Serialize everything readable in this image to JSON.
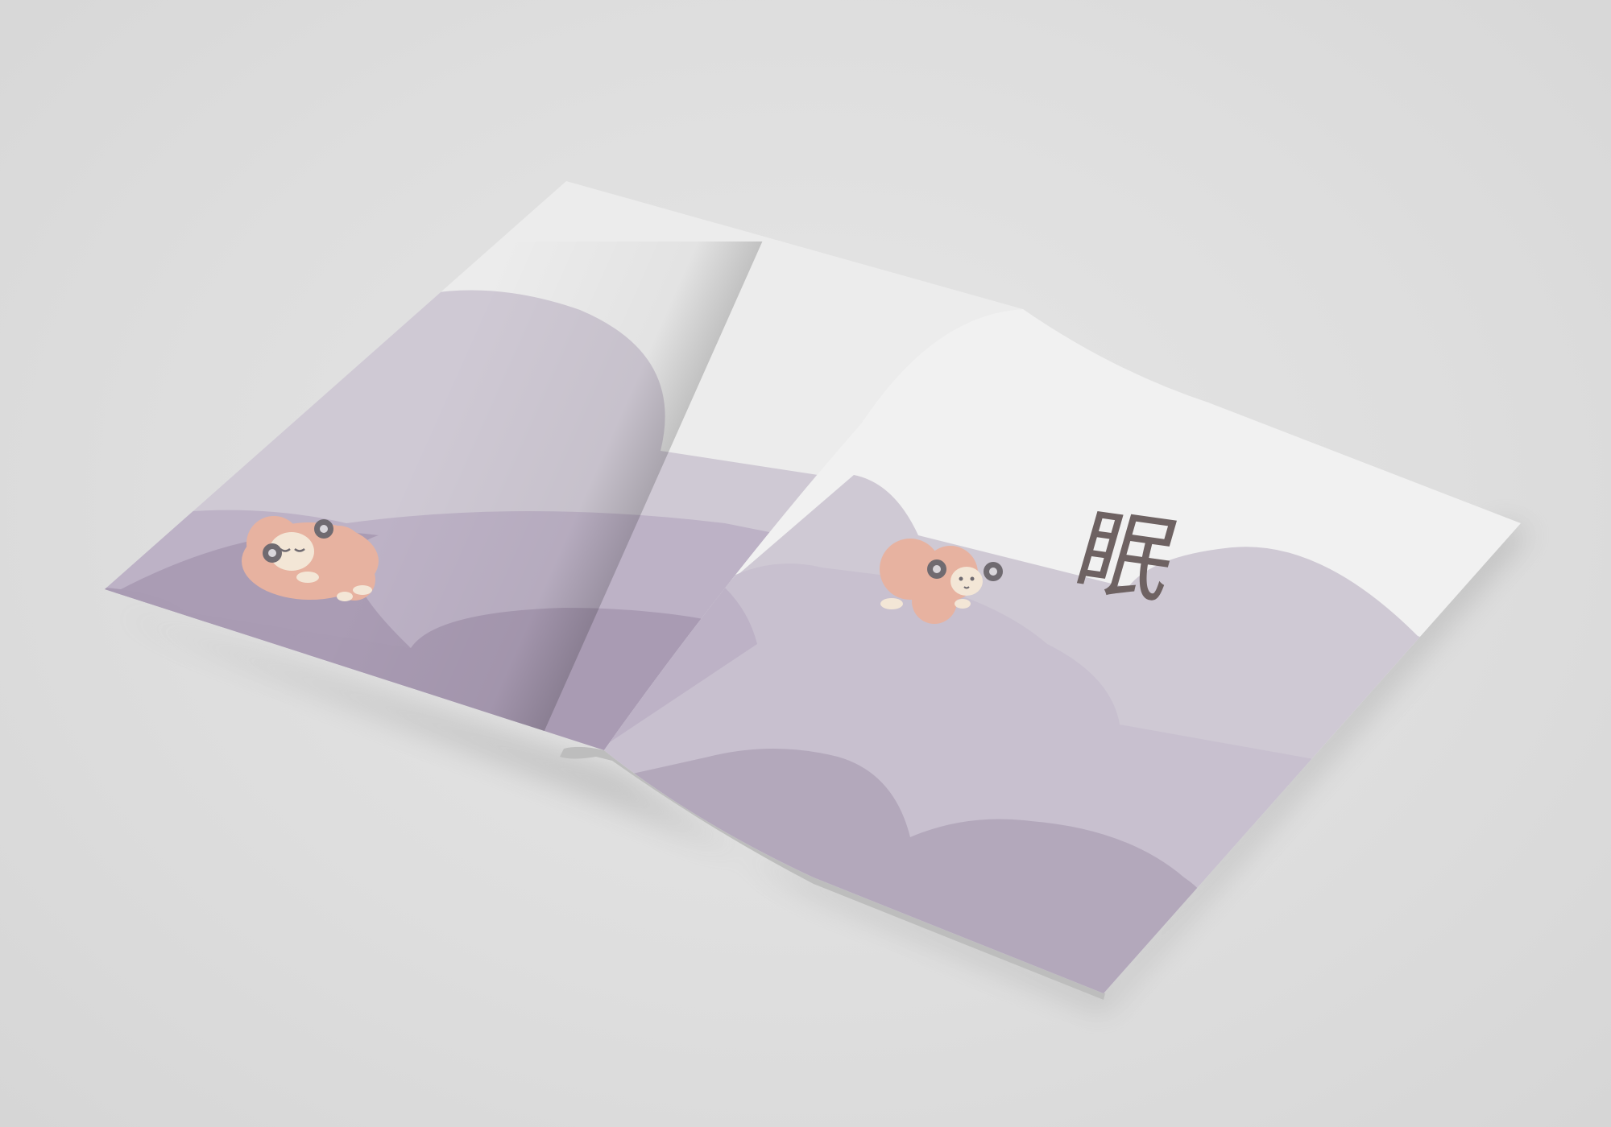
{
  "scene": {
    "type": "open magazine mockup"
  },
  "right_page": {
    "title_char": "眠"
  },
  "colors": {
    "background": "#dcdcdc",
    "paper": "#f1f1f1",
    "hill_light": "#cfc9d4",
    "hill_mid": "#bdb2c6",
    "hill_dark": "#a99bb3",
    "sheep_body": "#e7b2a0",
    "sheep_face": "#f3e6d6",
    "sheep_horn": "#6f6a70",
    "title_text": "#6e6262"
  },
  "icons": [
    "sleeping-sheep-icon",
    "sitting-sheep-icon"
  ]
}
